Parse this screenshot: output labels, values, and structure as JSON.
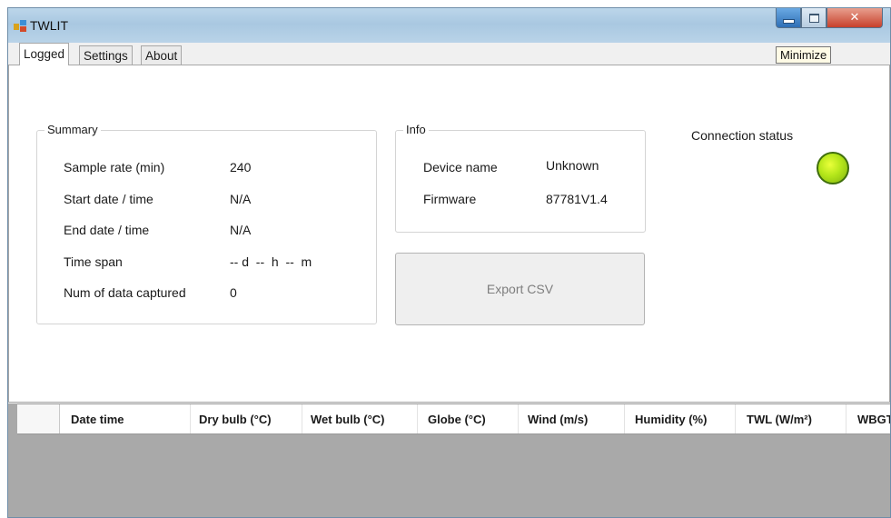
{
  "window": {
    "title": "TWLIT"
  },
  "title_buttons": {
    "minimize_tooltip": "Minimize",
    "close_glyph": "✕"
  },
  "tabs": [
    {
      "label": "Logged",
      "active": true
    },
    {
      "label": "Settings",
      "active": false
    },
    {
      "label": "About",
      "active": false
    }
  ],
  "summary": {
    "title": "Summary",
    "rows": [
      {
        "label": "Sample rate (min)",
        "value": "240"
      },
      {
        "label": "Start date / time",
        "value": "N/A"
      },
      {
        "label": "End date / time",
        "value": "N/A"
      },
      {
        "label": "Time span",
        "value": "-- d  --  h  --  m"
      },
      {
        "label": "Num of data captured",
        "value": "0"
      }
    ]
  },
  "info": {
    "title": "Info",
    "rows": [
      {
        "label": "Device name",
        "value": "Unknown"
      },
      {
        "label": "Firmware",
        "value": "87781V1.4"
      }
    ]
  },
  "export_button": {
    "label": "Export CSV",
    "enabled": false
  },
  "connection": {
    "label": "Connection status",
    "indicator_color": "#a8e01a"
  },
  "grid": {
    "columns": [
      "Date time",
      "Dry bulb (°C)",
      "Wet bulb (°C)",
      "Globe (°C)",
      "Wind (m/s)",
      "Humidity (%)",
      "TWL (W/m²)",
      "WBGT"
    ],
    "rows": []
  },
  "colors": {
    "titlebar": "#b1cde4",
    "close_button": "#c7402b",
    "grid_empty": "#a9a9a9"
  }
}
